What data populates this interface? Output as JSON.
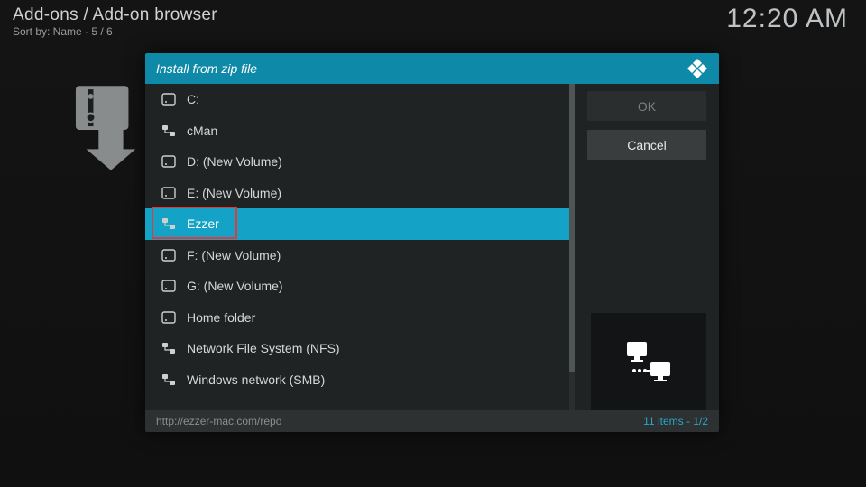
{
  "header": {
    "title": "Add-ons / Add-on browser",
    "sort_label": "Sort by: Name  ·  5 / 6",
    "clock": "12:20 AM"
  },
  "dialog": {
    "title": "Install from zip file",
    "buttons": {
      "ok": "OK",
      "cancel": "Cancel"
    },
    "footer_path": "http://ezzer-mac.com/repo",
    "footer_count": "11 items",
    "footer_page": "1/2",
    "items": [
      {
        "label": "C:",
        "icon": "drive"
      },
      {
        "label": "cMan",
        "icon": "net"
      },
      {
        "label": "D: (New Volume)",
        "icon": "drive"
      },
      {
        "label": "E: (New Volume)",
        "icon": "drive"
      },
      {
        "label": "Ezzer",
        "icon": "net",
        "selected": true
      },
      {
        "label": "F: (New Volume)",
        "icon": "drive"
      },
      {
        "label": "G: (New Volume)",
        "icon": "drive"
      },
      {
        "label": "Home folder",
        "icon": "drive"
      },
      {
        "label": "Network File System (NFS)",
        "icon": "net"
      },
      {
        "label": "Windows network (SMB)",
        "icon": "net"
      }
    ]
  }
}
